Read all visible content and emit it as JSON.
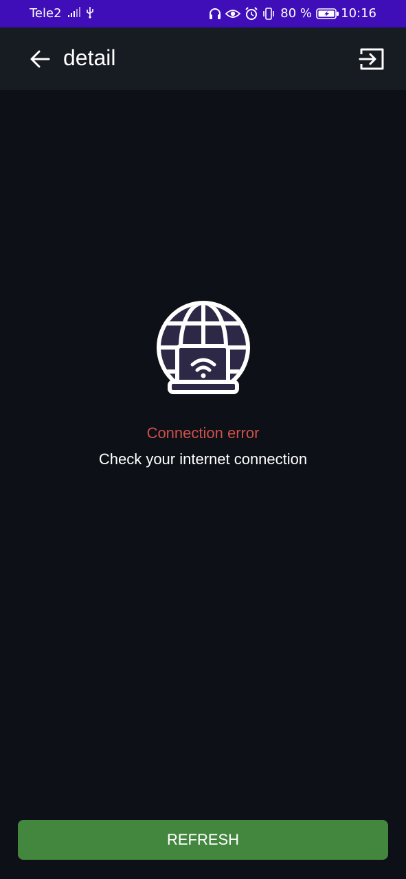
{
  "status_bar": {
    "carrier": "Tele2",
    "battery_percent": "80 %",
    "time": "10:16",
    "icons": [
      "signal-icon",
      "usb-icon",
      "headphones-icon",
      "eye-icon",
      "alarm-icon",
      "vibrate-icon",
      "battery-icon"
    ],
    "background_color": "#3f0eb8"
  },
  "app_bar": {
    "title": "detail",
    "icons": [
      "back-arrow-icon",
      "exit-icon"
    ]
  },
  "error": {
    "icon": "globe-laptop-wifi-icon",
    "title": "Connection error",
    "message": "Check your internet connection",
    "title_color": "#d0504a"
  },
  "actions": {
    "refresh_label": "REFRESH",
    "refresh_color": "#43873f"
  }
}
